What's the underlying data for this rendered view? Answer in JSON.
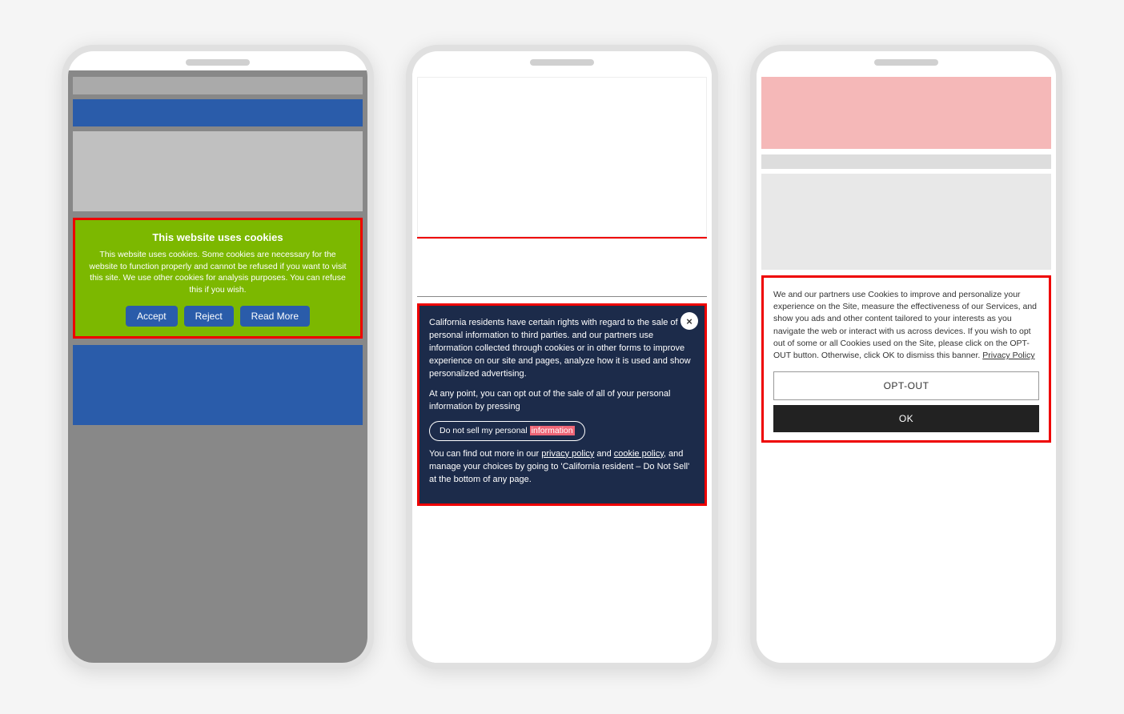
{
  "phone1": {
    "banner": {
      "title": "This website uses cookies",
      "body": "This website uses cookies. Some cookies are necessary for the website to function properly and cannot be refused if you want to visit this site. We use other cookies for analysis purposes. You can refuse this if you wish.",
      "accept_label": "Accept",
      "reject_label": "Reject",
      "read_more_label": "Read More"
    }
  },
  "phone2": {
    "banner": {
      "close_label": "×",
      "para1": "California residents have certain rights with regard to the sale of personal information to third parties.",
      "para1_cont": "and our partners use information collected through cookies or in other forms to improve experience on our site and pages, analyze how it is used and show personalized advertising.",
      "para2": "At any point, you can opt out of the sale of all of your personal information by pressing",
      "do_not_sell_label": "Do not sell my personal information",
      "para3_start": "You can find out more in our",
      "privacy_policy_label": "privacy policy",
      "para3_mid": "and",
      "cookie_policy_label": "cookie policy",
      "para3_end": ", and manage your choices by going to 'California resident – Do Not Sell' at the bottom of any page."
    }
  },
  "phone3": {
    "banner": {
      "body": "We and our partners use Cookies to improve and personalize your experience on the Site, measure the effectiveness of our Services, and show you ads and other content tailored to your interests as you navigate the web or interact with us across devices. If you wish to opt out of some or all Cookies used on the Site, please click on the OPT-OUT button. Otherwise, click OK to dismiss this banner.",
      "privacy_policy_label": "Privacy Policy",
      "opt_out_label": "OPT-OUT",
      "ok_label": "OK"
    }
  }
}
